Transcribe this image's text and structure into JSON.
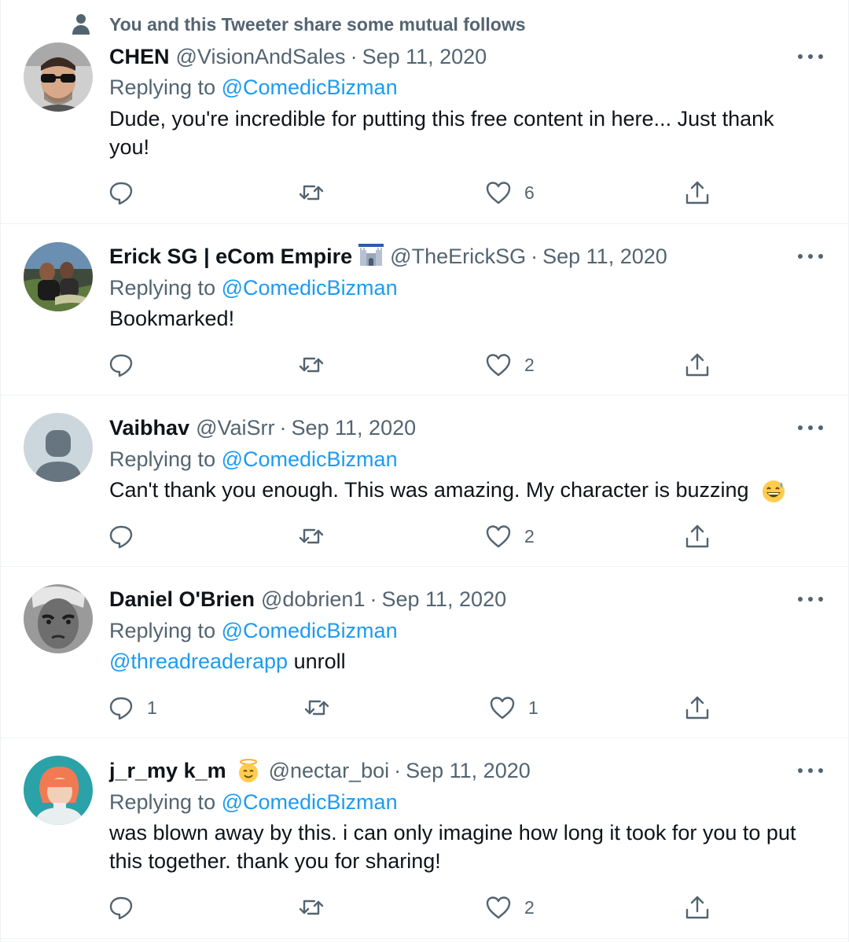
{
  "social_context": {
    "text": "You and this Tweeter share some mutual follows",
    "icon": "person-icon"
  },
  "reply_prefix": "Replying to",
  "colors": {
    "link": "#1d9bf0",
    "secondary_text": "#536471",
    "primary_text": "#0f1419",
    "divider": "#eff3f4"
  },
  "tweets": [
    {
      "name": "CHEN",
      "name_emoji": "",
      "handle": "@VisionAndSales",
      "date": "Sep 11, 2020",
      "replying_to": "@ComedicBizman",
      "text_line1": "Dude, you're incredible for putting this free content in here... Just thank",
      "text_line2": "you!",
      "reply_count": "",
      "retweet_count": "",
      "like_count": "6"
    },
    {
      "name": "Erick SG | eCom Empire",
      "name_emoji": "castle-emoji",
      "handle": "@TheErickSG",
      "date": "Sep 11, 2020",
      "replying_to": "@ComedicBizman",
      "text": "Bookmarked!",
      "reply_count": "",
      "retweet_count": "",
      "like_count": "2"
    },
    {
      "name": "Vaibhav",
      "name_emoji": "",
      "handle": "@VaiSrr",
      "date": "Sep 11, 2020",
      "replying_to": "@ComedicBizman",
      "text": "Can't thank you enough. This was amazing. My character is buzzing",
      "text_emoji": "grinning-sweat-emoji",
      "reply_count": "",
      "retweet_count": "",
      "like_count": "2"
    },
    {
      "name": "Daniel O'Brien",
      "name_emoji": "",
      "handle": "@dobrien1",
      "date": "Sep 11, 2020",
      "replying_to": "@ComedicBizman",
      "mention": "@threadreaderapp",
      "text": " unroll",
      "reply_count": "1",
      "retweet_count": "",
      "like_count": "1"
    },
    {
      "name": "j_r_my k_m",
      "name_emoji": "angel-emoji",
      "handle": "@nectar_boi",
      "date": "Sep 11, 2020",
      "replying_to": "@ComedicBizman",
      "text_line1": "was blown away by this. i can only imagine how long it took for you to put",
      "text_line2": "this together. thank you for sharing!",
      "reply_count": "",
      "retweet_count": "",
      "like_count": "2"
    }
  ]
}
